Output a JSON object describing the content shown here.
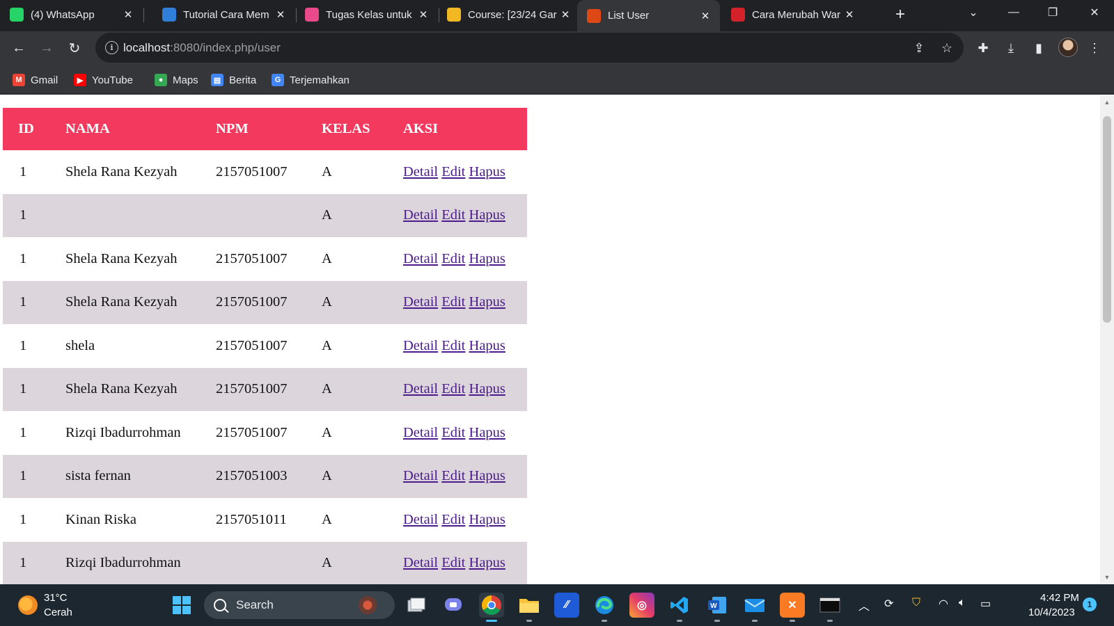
{
  "browser": {
    "tabs": [
      {
        "title": "(4) WhatsApp",
        "icon": "whatsapp-icon",
        "color": "#25d366"
      },
      {
        "title": "Tutorial Cara Mem",
        "icon": "site-logo-icon",
        "color": "#2f7fd8"
      },
      {
        "title": "Tugas Kelas untuk",
        "icon": "classroom-icon",
        "color": "#e84a8b"
      },
      {
        "title": "Course: [23/24 Gar",
        "icon": "course-icon",
        "color": "#f2b824"
      },
      {
        "title": "List User",
        "icon": "codeigniter-flame-icon",
        "color": "#dd4814"
      },
      {
        "title": "Cara Merubah War",
        "icon": "pin-icon",
        "color": "#d3222a"
      }
    ],
    "active_tab": 4,
    "url_host": "localhost",
    "url_path": ":8080/index.php/user"
  },
  "bookmarks": [
    {
      "label": "Gmail",
      "icon": "gmail-icon",
      "color": "#ea4335"
    },
    {
      "label": "YouTube",
      "icon": "youtube-icon",
      "color": "#ff0000"
    },
    {
      "label": "Maps",
      "icon": "maps-pin-icon",
      "color": "#34a853"
    },
    {
      "label": "Berita",
      "icon": "news-icon",
      "color": "#4285f4"
    },
    {
      "label": "Terjemahkan",
      "icon": "translate-icon",
      "color": "#4285f4"
    }
  ],
  "table": {
    "header_color": "#f33a5e",
    "stripe_color": "#dcd6dc",
    "link_color": "#4b1b8c",
    "columns": [
      "ID",
      "NAMA",
      "NPM",
      "KELAS",
      "AKSI"
    ],
    "actions": [
      "Detail",
      "Edit",
      "Hapus"
    ],
    "rows": [
      {
        "id": "1",
        "nama": "Shela Rana Kezyah",
        "npm": "2157051007",
        "kelas": "A"
      },
      {
        "id": "1",
        "nama": "",
        "npm": "",
        "kelas": "A"
      },
      {
        "id": "1",
        "nama": "Shela Rana Kezyah",
        "npm": "2157051007",
        "kelas": "A"
      },
      {
        "id": "1",
        "nama": "Shela Rana Kezyah",
        "npm": "2157051007",
        "kelas": "A"
      },
      {
        "id": "1",
        "nama": "shela",
        "npm": "2157051007",
        "kelas": "A"
      },
      {
        "id": "1",
        "nama": "Shela Rana Kezyah",
        "npm": "2157051007",
        "kelas": "A"
      },
      {
        "id": "1",
        "nama": "Rizqi Ibadurrohman",
        "npm": "2157051007",
        "kelas": "A"
      },
      {
        "id": "1",
        "nama": "sista fernan",
        "npm": "2157051003",
        "kelas": "A"
      },
      {
        "id": "1",
        "nama": "Kinan Riska",
        "npm": "2157051011",
        "kelas": "A"
      },
      {
        "id": "1",
        "nama": "Rizqi Ibadurrohman",
        "npm": "",
        "kelas": "A"
      }
    ]
  },
  "taskbar": {
    "weather_temp": "31°C",
    "weather_desc": "Cerah",
    "search_placeholder": "Search",
    "time": "4:42 PM",
    "date": "10/4/2023",
    "notification_count": "1"
  }
}
